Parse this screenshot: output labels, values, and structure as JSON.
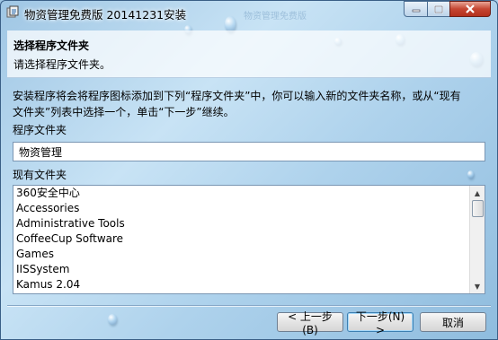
{
  "window": {
    "title": "物资管理免费版 20141231安装",
    "ghost_title": "物资管理免费版"
  },
  "header": {
    "title": "选择程序文件夹",
    "subtitle": "请选择程序文件夹。"
  },
  "main": {
    "description_line1": "安装程序将会将程序图标添加到下列“程序文件夹”中，你可以输入新的文件夹名称，或从“现有",
    "description_line2": "文件夹”列表中选择一个，单击“下一步”继续。",
    "folder_label": "程序文件夹",
    "folder_value": "物资管理",
    "existing_label": "现有文件夹",
    "existing_folders": [
      "360安全中心",
      "Accessories",
      "Administrative Tools",
      "CoffeeCup Software",
      "Games",
      "IISSystem",
      "Kamus 2.04"
    ]
  },
  "buttons": {
    "back": "< 上一步(B)",
    "next": "下一步(N) >",
    "cancel": "取消"
  },
  "colors": {
    "accent_close": "#c54632",
    "frame": "#3a5f86"
  }
}
